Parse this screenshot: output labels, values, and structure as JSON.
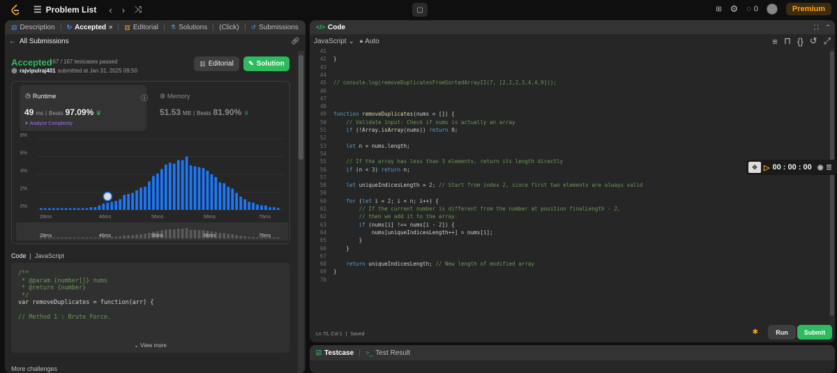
{
  "topbar": {
    "problem_list": "Problem List",
    "coin_count": "0",
    "premium": "Premium"
  },
  "tabs": [
    {
      "label": "Description"
    },
    {
      "label": "Accepted"
    },
    {
      "label": "Editorial"
    },
    {
      "label": "Solutions"
    },
    {
      "label": "(Click)"
    },
    {
      "label": "Submissions"
    }
  ],
  "submission": {
    "back_label": "All Submissions",
    "status": "Accepted",
    "passed": "167 / 167 testcases passed",
    "user": "rajvipulraj401",
    "submitted": "submitted at Jan 31, 2025 09:50",
    "editorial_btn": "Editorial",
    "solution_btn": "Solution"
  },
  "runtime": {
    "label": "Runtime",
    "value": "49",
    "unit": "ms",
    "beats_label": "Beats",
    "beats": "97.09%",
    "analyze": "Analyze Complexity"
  },
  "memory": {
    "label": "Memory",
    "value": "51.53",
    "unit": "MB",
    "beats_label": "Beats",
    "beats": "81.90%"
  },
  "chart_data": {
    "type": "bar",
    "ylim": [
      0,
      8
    ],
    "yticks": [
      "8%",
      "6%",
      "4%",
      "2%",
      "0%"
    ],
    "xticks": [
      "28ms",
      "46ms",
      "56ms",
      "66ms",
      "76ms"
    ],
    "mini_xticks": [
      "28ms",
      "46ms",
      "56ms",
      "66ms",
      "76ms"
    ],
    "values": [
      0.2,
      0.2,
      0.2,
      0.2,
      0.2,
      0.2,
      0.2,
      0.2,
      0.2,
      0.2,
      0.2,
      0.2,
      0.3,
      0.3,
      0.5,
      0.7,
      0.8,
      0.9,
      1.0,
      1.2,
      1.7,
      1.8,
      1.9,
      2.2,
      2.5,
      2.6,
      3.2,
      3.8,
      4.1,
      4.6,
      5.1,
      5.3,
      5.2,
      5.6,
      5.6,
      6.0,
      5.0,
      4.9,
      4.8,
      4.7,
      4.4,
      4.0,
      3.7,
      3.1,
      3.0,
      2.6,
      2.4,
      1.9,
      1.5,
      1.2,
      0.9,
      0.8,
      0.6,
      0.5,
      0.5,
      0.3,
      0.3,
      0.2
    ],
    "highlight_index": 16
  },
  "code_preview": {
    "header": "Code",
    "language": "JavaScript",
    "lines": [
      "/**",
      " * @param {number[]} nums",
      " * @return {number}",
      " */",
      "var removeDuplicates = function(arr) {",
      "",
      "// Method 1 : Brute Force."
    ],
    "view_more": "View more"
  },
  "more_challenges": "More challenges",
  "editor": {
    "title": "Code",
    "language": "JavaScript",
    "mode": "Auto",
    "status": "Ln 70, Col 1",
    "saved": "Saved",
    "run": "Run",
    "submit": "Submit",
    "lines": [
      {
        "n": "41",
        "t": ""
      },
      {
        "n": "42",
        "t": "}"
      },
      {
        "n": "43",
        "t": ""
      },
      {
        "n": "44",
        "t": ""
      },
      {
        "n": "45",
        "t": "// console.log(removeDuplicatesFromSortedArrayII(7, [2,2,2,3,4,4,9]));"
      },
      {
        "n": "46",
        "t": ""
      },
      {
        "n": "47",
        "t": ""
      },
      {
        "n": "48",
        "t": ""
      },
      {
        "n": "49",
        "t": "function removeDuplicates(nums = []) {"
      },
      {
        "n": "50",
        "t": "    // Validate input: Check if nums is actually an array"
      },
      {
        "n": "51",
        "t": "    if (!Array.isArray(nums)) return 0;"
      },
      {
        "n": "52",
        "t": ""
      },
      {
        "n": "53",
        "t": "    let n = nums.length;"
      },
      {
        "n": "54",
        "t": ""
      },
      {
        "n": "55",
        "t": "    // If the array has less than 3 elements, return its length directly"
      },
      {
        "n": "56",
        "t": "    if (n < 3) return n;"
      },
      {
        "n": "57",
        "t": ""
      },
      {
        "n": "58",
        "t": "    let uniqueIndicesLength = 2; // Start from index 2, since first two elements are always valid"
      },
      {
        "n": "59",
        "t": ""
      },
      {
        "n": "60",
        "t": "    for (let i = 2; i < n; i++) {"
      },
      {
        "n": "61",
        "t": "        // If the current number is different from the number at position finalLength - 2,"
      },
      {
        "n": "62",
        "t": "        // then we add it to the array."
      },
      {
        "n": "63",
        "t": "        if (nums[i] !== nums[i - 2]) {"
      },
      {
        "n": "64",
        "t": "            nums[uniqueIndicesLength++] = nums[i];"
      },
      {
        "n": "65",
        "t": "        }"
      },
      {
        "n": "66",
        "t": "    }"
      },
      {
        "n": "67",
        "t": ""
      },
      {
        "n": "68",
        "t": "    return uniqueIndicesLength; // New length of modified array"
      },
      {
        "n": "69",
        "t": "}"
      },
      {
        "n": "70",
        "t": ""
      }
    ]
  },
  "timer": "00 : 00 : 00",
  "bottom": {
    "testcase": "Testcase",
    "test_result": "Test Result"
  }
}
